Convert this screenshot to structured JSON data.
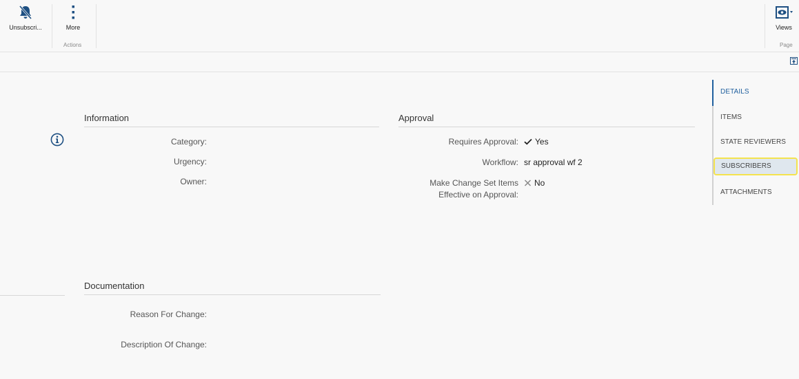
{
  "ribbon": {
    "unsubscribe_label": "Unsubscri...",
    "more_label": "More",
    "actions_group": "Actions",
    "views_label": "Views",
    "page_group": "Page"
  },
  "information": {
    "title": "Information",
    "fields": [
      {
        "label": "Category:",
        "value": ""
      },
      {
        "label": "Urgency:",
        "value": ""
      },
      {
        "label": "Owner:",
        "value": ""
      }
    ]
  },
  "approval": {
    "title": "Approval",
    "requires_approval_label": "Requires Approval:",
    "requires_approval_value": "Yes",
    "workflow_label": "Workflow:",
    "workflow_value": "sr approval wf 2",
    "make_effective_label_1": "Make Change Set Items",
    "make_effective_label_2": "Effective on Approval:",
    "make_effective_value": "No"
  },
  "documentation": {
    "title": "Documentation",
    "reason_label": "Reason For Change:",
    "description_label": "Description Of Change:"
  },
  "nav": {
    "items": [
      "DETAILS",
      "ITEMS",
      "STATE REVIEWERS",
      "SUBSCRIBERS",
      "ATTACHMENTS"
    ],
    "active": "DETAILS",
    "highlighted": "SUBSCRIBERS"
  },
  "colors": {
    "accent": "#1f5f9e",
    "highlight_border": "#f4e34d",
    "highlight_bg": "#dfe7ee"
  }
}
